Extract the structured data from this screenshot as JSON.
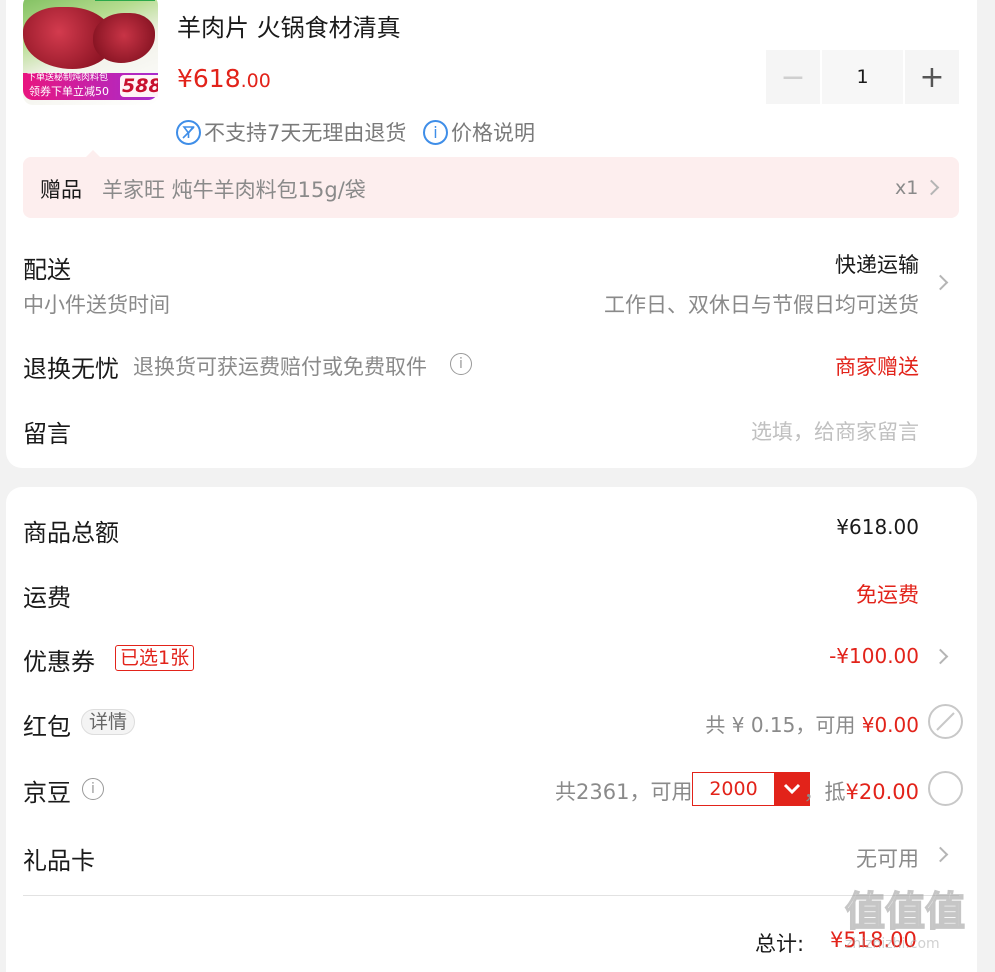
{
  "product": {
    "title": "羊肉片 火锅食材清真",
    "price_main": "¥618",
    "price_decimal": ".00",
    "thumbnail": {
      "promo_top": "下单送秘制炖肉料包",
      "promo_bottom": "领券下单立减50",
      "badge_price": "588"
    },
    "quantity": "1",
    "minus_label": "−",
    "plus_label": "+",
    "service_icon": "no-return-icon",
    "service_no_return": "不支持7天无理由退货",
    "price_info_label": "价格说明"
  },
  "gift": {
    "label": "赠品",
    "name": "羊家旺 炖牛羊肉料包15g/袋",
    "qty": "x1"
  },
  "delivery": {
    "label": "配送",
    "method": "快递运输",
    "time_label": "中小件送货时间",
    "time_value": "工作日、双休日与节假日均可送货"
  },
  "returns": {
    "label": "退换无忧",
    "desc": "退换货可获运费赔付或免费取件",
    "value": "商家赠送"
  },
  "message": {
    "label": "留言",
    "placeholder": "选填，给商家留言"
  },
  "summary": {
    "goods_total_label": "商品总额",
    "goods_total_value": "¥618.00",
    "shipping_label": "运费",
    "shipping_value": "免运费",
    "coupon_label": "优惠券",
    "coupon_tag": "已选1张",
    "coupon_value": "-¥100.00",
    "redpacket_label": "红包",
    "redpacket_tag": "详情",
    "redpacket_prefix": "共 ¥ 0.15，可用 ",
    "redpacket_value": "¥0.00",
    "jingdou_label": "京豆",
    "jingdou_prefix": "共2361，可用",
    "jingdou_select": "2000",
    "jingdou_suffix": "，抵",
    "jingdou_value": "¥20.00",
    "giftcard_label": "礼品卡",
    "giftcard_value": "无可用",
    "total_label": "总计:",
    "total_value": "¥518.00"
  },
  "watermark": {
    "logo": "值值值",
    "site": "zhizhizhi.com"
  },
  "colors": {
    "accent_red": "#e2231a",
    "info_blue": "#3f8ee8",
    "gift_bg": "#fdeeee"
  }
}
